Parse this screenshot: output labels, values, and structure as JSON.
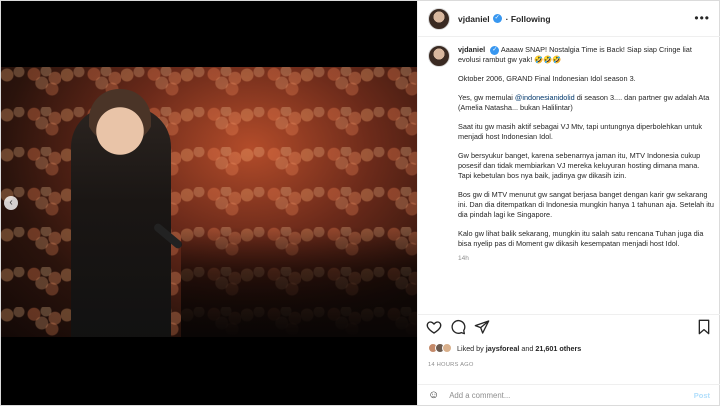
{
  "post": {
    "username": "vjdaniel",
    "follow_label": "Following",
    "more_label": "•••",
    "caption": {
      "author": "vjdaniel",
      "line1": "Aaaaw SNAP! Nostalgia Time is Back! Siap siap Cringe liat evolusi rambut gw yak! 🤣🤣🤣",
      "p1": "Oktober 2006, GRAND Final Indonesian Idol season 3.",
      "p2_pre": "Yes, gw memulai ",
      "p2_mention": "@indonesianidolid",
      "p2_post": " di season 3.... dan partner gw adalah Ata (Amelia Natasha... bukan Halilintar)",
      "p3": "Saat itu gw masih aktif sebagai VJ Mtv, tapi untungnya diperbolehkan untuk menjadi host Indonesian Idol.",
      "p4": "Gw bersyukur banget, karena sebenarnya jaman itu, MTV Indonesia cukup posesif dan tidak membiarkan VJ mereka keluyuran hosting dimana mana. Tapi kebetulan bos nya baik, jadinya gw dikasih izin.",
      "p5": "Bos gw di MTV menurut gw sangat berjasa banget dengan karir gw sekarang ini. Dan dia ditempatkan di Indonesia mungkin hanya 1 tahunan aja. Setelah itu dia pindah lagi ke Singapore.",
      "p6": "Kalo gw lihat balik sekarang, mungkin itu salah satu rencana Tuhan juga dia bisa nyelip pas di Moment gw dikasih kesempatan menjadi host Idol.",
      "age": "14h"
    },
    "likes": {
      "prefix": "Liked by ",
      "user": "jaysforeal",
      "mid": " and ",
      "count": "21,601 others"
    },
    "time_ago": "14 HOURS AGO",
    "comment": {
      "emoji": "☺",
      "placeholder": "Add a comment...",
      "post_label": "Post"
    }
  },
  "icons": [
    "heart-icon",
    "comment-icon",
    "share-icon",
    "bookmark-icon",
    "verified-icon",
    "chevron-left-icon"
  ],
  "colors": {
    "verified": "#3897f0",
    "link": "#00376b",
    "post_btn": "#b2dffc"
  }
}
